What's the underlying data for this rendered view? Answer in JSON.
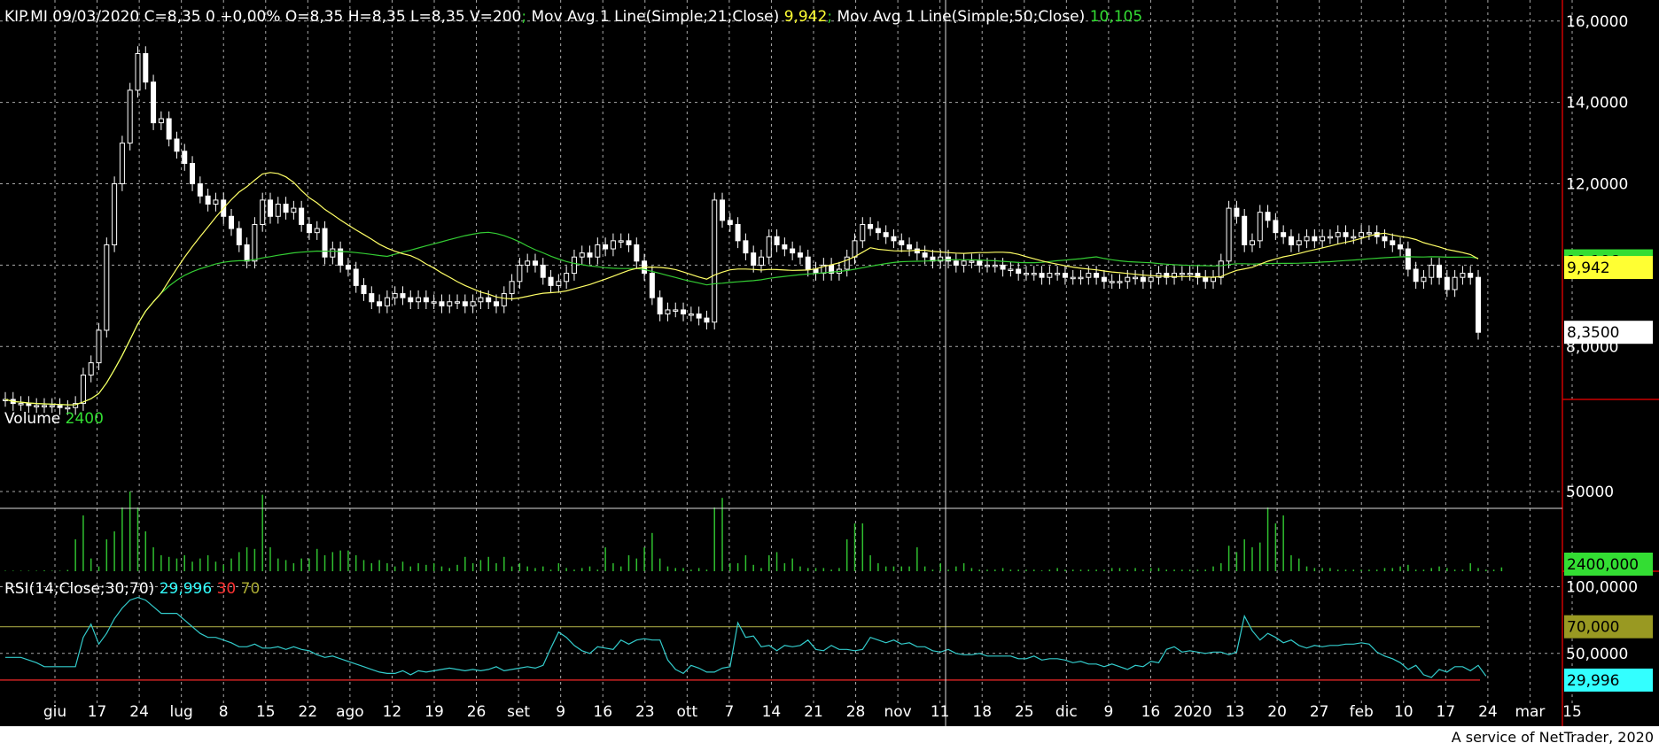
{
  "header": {
    "ticker": "KIP.MI",
    "date": "09/03/2020",
    "ohlc": "C=8,35 0 +0,00% O=8,35 H=8,35 L=8,35 V=200",
    "sep": ";",
    "ma21_label": "Mov Avg 1 Line(Simple;21;Close)",
    "ma21_value": "9,942",
    "ma50_label": "Mov Avg 1 Line(Simple;50;Close)",
    "ma50_value": "10,105"
  },
  "volume_panel": {
    "label": "Volume",
    "value": "2400"
  },
  "rsi_panel": {
    "label": "RSI(14;Close;30;70)",
    "value": "29,996",
    "low": "30",
    "high": "70"
  },
  "footer": {
    "credit": "A service of NetTrader, 2020"
  },
  "colors": {
    "background": "#000000",
    "candle_up": "#ffffff",
    "ma21": "#ffff66",
    "ma50": "#33cc33",
    "volume_bar": "#2fbf2f",
    "rsi_line": "#33cccc",
    "rsi_level_high": "#a0a040",
    "rsi_level_low": "#cc2222",
    "axis_border": "#cc0000",
    "grid": "#aaaaaa"
  },
  "chart_data": {
    "type": "candlestick",
    "price_axis": {
      "ticks": [
        {
          "v": 16,
          "label": "16,0000"
        },
        {
          "v": 14,
          "label": "14,0000"
        },
        {
          "v": 12,
          "label": "12,0000"
        },
        {
          "v": 10,
          "label": ""
        },
        {
          "v": 8,
          "label": "8,0000"
        }
      ],
      "ylim": [
        6.7,
        16.3
      ],
      "badges": [
        {
          "value": 10.106,
          "label": "10,106",
          "color": "#33dd33"
        },
        {
          "value": 9.942,
          "label": "9,942",
          "color": "#ffff33"
        },
        {
          "value": 8.35,
          "label": "8,3500",
          "color": "#ffffff"
        }
      ]
    },
    "volume_axis": {
      "ticks": [
        {
          "v": 50000,
          "label": "50000"
        }
      ],
      "ylim": [
        0,
        100000
      ],
      "badge": {
        "value": 2400,
        "label": "2400,000",
        "color": "#33dd33"
      }
    },
    "rsi_axis": {
      "ticks": [
        {
          "v": 100,
          "label": "100,0000"
        },
        {
          "v": 50,
          "label": "50,0000"
        }
      ],
      "ylim": [
        12,
        105
      ],
      "levels": [
        70,
        30
      ],
      "badges": [
        {
          "value": 70,
          "label": "70,000",
          "color": "#999922"
        },
        {
          "value": 29.996,
          "label": "29,996",
          "color": "#33ffff"
        }
      ]
    },
    "x_labels": [
      "giu",
      "17",
      "24",
      "lug",
      "8",
      "15",
      "22",
      "ago",
      "12",
      "19",
      "26",
      "set",
      "9",
      "16",
      "23",
      "ott",
      "7",
      "14",
      "21",
      "28",
      "nov",
      "11",
      "18",
      "25",
      "dic",
      "9",
      "16",
      "2020",
      "13",
      "20",
      "27",
      "feb",
      "10",
      "17",
      "24",
      "mar",
      "15"
    ],
    "closes": [
      6.7,
      6.6,
      6.6,
      6.55,
      6.55,
      6.55,
      6.55,
      6.5,
      6.5,
      6.6,
      7.3,
      7.6,
      8.4,
      10.5,
      12,
      13,
      14.3,
      15.2,
      14.5,
      13.5,
      13.6,
      13.1,
      12.8,
      12.5,
      12.0,
      11.7,
      11.5,
      11.6,
      11.2,
      10.9,
      10.5,
      10.1,
      11.0,
      11.6,
      11.2,
      11.5,
      11.3,
      11.4,
      11.0,
      10.8,
      10.9,
      10.2,
      10.4,
      10.0,
      9.9,
      9.5,
      9.3,
      9.1,
      9.0,
      9.2,
      9.3,
      9.2,
      9.1,
      9.2,
      9.1,
      9.1,
      9.0,
      9.1,
      9.1,
      9.0,
      9.1,
      9.2,
      9.1,
      9.0,
      9.3,
      9.6,
      10.0,
      10.1,
      10.0,
      9.7,
      9.5,
      9.6,
      9.8,
      10.2,
      10.3,
      10.2,
      10.5,
      10.4,
      10.6,
      10.6,
      10.5,
      10.1,
      9.8,
      9.2,
      8.8,
      8.9,
      8.9,
      8.8,
      8.8,
      8.7,
      8.6,
      11.6,
      11.1,
      11.0,
      10.6,
      10.3,
      10.0,
      10.2,
      10.7,
      10.5,
      10.4,
      10.3,
      10.2,
      9.9,
      9.8,
      10.0,
      9.8,
      9.9,
      10.2,
      10.6,
      11.0,
      10.9,
      10.8,
      10.7,
      10.6,
      10.5,
      10.4,
      10.3,
      10.2,
      10.1,
      10.2,
      10.1,
      10.0,
      10.1,
      10.1,
      10.0,
      10.0,
      10.0,
      9.9,
      9.9,
      9.8,
      9.8,
      9.8,
      9.7,
      9.8,
      9.8,
      9.7,
      9.7,
      9.7,
      9.8,
      9.7,
      9.6,
      9.6,
      9.6,
      9.7,
      9.7,
      9.6,
      9.7,
      9.8,
      9.7,
      9.8,
      9.8,
      9.8,
      9.7,
      9.6,
      9.7,
      10.1,
      11.4,
      11.2,
      10.5,
      10.6,
      11.3,
      11.1,
      10.8,
      10.7,
      10.5,
      10.6,
      10.7,
      10.6,
      10.7,
      10.7,
      10.8,
      10.7,
      10.7,
      10.8,
      10.8,
      10.7,
      10.6,
      10.5,
      10.4,
      9.9,
      9.6,
      9.7,
      10.0,
      9.7,
      9.4,
      9.7,
      9.8,
      9.7,
      8.35
    ],
    "volumes": [
      300,
      300,
      300,
      300,
      300,
      500,
      300,
      300,
      800,
      20000,
      35000,
      8000,
      3000,
      20000,
      25000,
      40000,
      50000,
      40000,
      25000,
      15000,
      10000,
      9000,
      8000,
      10000,
      6000,
      8000,
      10000,
      6000,
      4000,
      8000,
      12000,
      15000,
      14000,
      48000,
      15000,
      8000,
      7000,
      5000,
      8000,
      8000,
      14000,
      10000,
      12000,
      13000,
      13000,
      10000,
      7000,
      5000,
      7000,
      5000,
      3000,
      6000,
      3000,
      5000,
      4000,
      5000,
      3000,
      2000,
      4000,
      9000,
      5000,
      7000,
      9000,
      5000,
      9000,
      3000,
      5000,
      3000,
      2000,
      3000,
      1000,
      5000,
      2000,
      1000,
      2000,
      3000,
      1000,
      15000,
      5000,
      3000,
      10000,
      8000,
      15000,
      24000,
      8000,
      3000,
      2000,
      2000,
      1000,
      2000,
      1000,
      40000,
      46000,
      5000,
      5000,
      10000,
      4000,
      2000,
      10000,
      12000,
      5000,
      8000,
      3000,
      2000,
      2000,
      2000,
      1000,
      2000,
      20000,
      30000,
      30000,
      10000,
      5000,
      3000,
      3000,
      3000,
      3000,
      15000,
      3000,
      1000,
      5000,
      1000,
      3000,
      5000,
      2000,
      1000,
      1000,
      1000,
      2000,
      1000,
      1000,
      1000,
      1000,
      500,
      1000,
      2000,
      1000,
      1000,
      1000,
      1000,
      1000,
      1000,
      2000,
      2000,
      1000,
      2000,
      1000,
      2000,
      2000,
      1000,
      1000,
      1000,
      1000,
      1000,
      1000,
      3000,
      5000,
      16000,
      12000,
      20000,
      15000,
      18000,
      40000,
      30000,
      35000,
      10000,
      8000,
      3000,
      2000,
      2000,
      2000,
      1000,
      1000,
      1000,
      1000,
      1000,
      1000,
      2000,
      2000,
      3000,
      4000,
      1000,
      1000,
      2000,
      3000,
      2000,
      1000,
      1000,
      5000,
      2000,
      1000,
      1000,
      2400
    ],
    "rsi": [
      47,
      47,
      47,
      45,
      43,
      40,
      40,
      40,
      40,
      40,
      62,
      72,
      57,
      65,
      76,
      84,
      90,
      92,
      90,
      85,
      80,
      80,
      80,
      75,
      70,
      65,
      62,
      62,
      60,
      58,
      55,
      55,
      57,
      54,
      54,
      55,
      53,
      55,
      53,
      52,
      49,
      47,
      48,
      46,
      44,
      42,
      40,
      38,
      36,
      35,
      35,
      37,
      34,
      37,
      36,
      37,
      38,
      39,
      38,
      37,
      38,
      37,
      38,
      40,
      37,
      38,
      39,
      40,
      39,
      41,
      54,
      66,
      62,
      56,
      52,
      50,
      55,
      54,
      53,
      60,
      57,
      60,
      61,
      60,
      60,
      45,
      38,
      35,
      41,
      39,
      36,
      36,
      39,
      40,
      73,
      62,
      63,
      55,
      56,
      52,
      56,
      55,
      56,
      60,
      53,
      52,
      56,
      53,
      53,
      52,
      53,
      62,
      60,
      58,
      60,
      57,
      58,
      55,
      55,
      52,
      51,
      53,
      50,
      49,
      49,
      50,
      48,
      48,
      48,
      48,
      46,
      46,
      48,
      45,
      46,
      46,
      45,
      43,
      44,
      42,
      42,
      40,
      42,
      40,
      38,
      41,
      40,
      44,
      43,
      53,
      55,
      51,
      52,
      51,
      50,
      51,
      51,
      49,
      51,
      78,
      67,
      60,
      65,
      62,
      58,
      60,
      56,
      54,
      56,
      55,
      56,
      56,
      57,
      57,
      58,
      57,
      51,
      48,
      46,
      43,
      38,
      41,
      34,
      32,
      38,
      36,
      40,
      40,
      37,
      41,
      33
    ]
  }
}
